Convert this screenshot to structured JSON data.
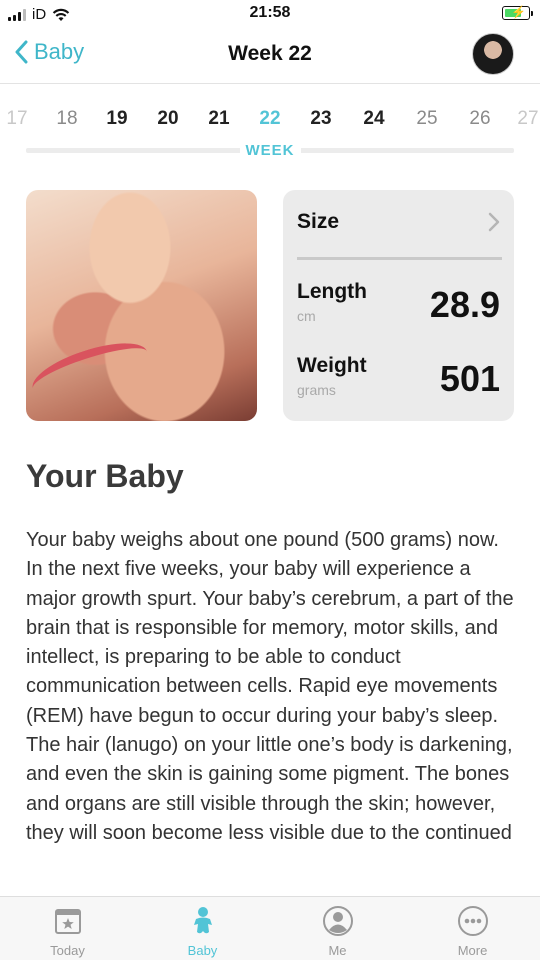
{
  "status_bar": {
    "carrier": "iD",
    "time": "21:58",
    "battery_level": 0.6
  },
  "nav": {
    "back_label": "Baby",
    "title": "Week 22"
  },
  "weeks": {
    "items": [
      "17",
      "18",
      "19",
      "20",
      "21",
      "22",
      "23",
      "24",
      "25",
      "26",
      "27"
    ],
    "selected": "22",
    "label": "WEEK"
  },
  "size_card": {
    "title": "Size",
    "length": {
      "label": "Length",
      "unit": "cm",
      "value": "28.9"
    },
    "weight": {
      "label": "Weight",
      "unit": "grams",
      "value": "501"
    }
  },
  "content": {
    "heading": "Your Baby",
    "body": "Your baby weighs about one pound (500 grams) now. In the next five weeks, your baby will experience a major growth spurt. Your baby’s cerebrum, a part of the brain that is responsible for memory, motor skills, and intellect, is preparing to be able to conduct communication between cells. Rapid eye movements (REM) have begun to occur during your baby’s sleep. The hair (lanugo) on your little one’s body is darkening, and even the skin is gaining some pigment. The bones and organs are still visible through the skin; however, they will soon become less visible due to the continued"
  },
  "tabs": [
    {
      "label": "Today",
      "icon": "calendar-icon"
    },
    {
      "label": "Baby",
      "icon": "baby-icon"
    },
    {
      "label": "Me",
      "icon": "person-icon"
    },
    {
      "label": "More",
      "icon": "more-icon"
    }
  ],
  "colors": {
    "accent": "#52c4d6",
    "link": "#3fb6c9",
    "card_bg": "#ebebeb"
  }
}
